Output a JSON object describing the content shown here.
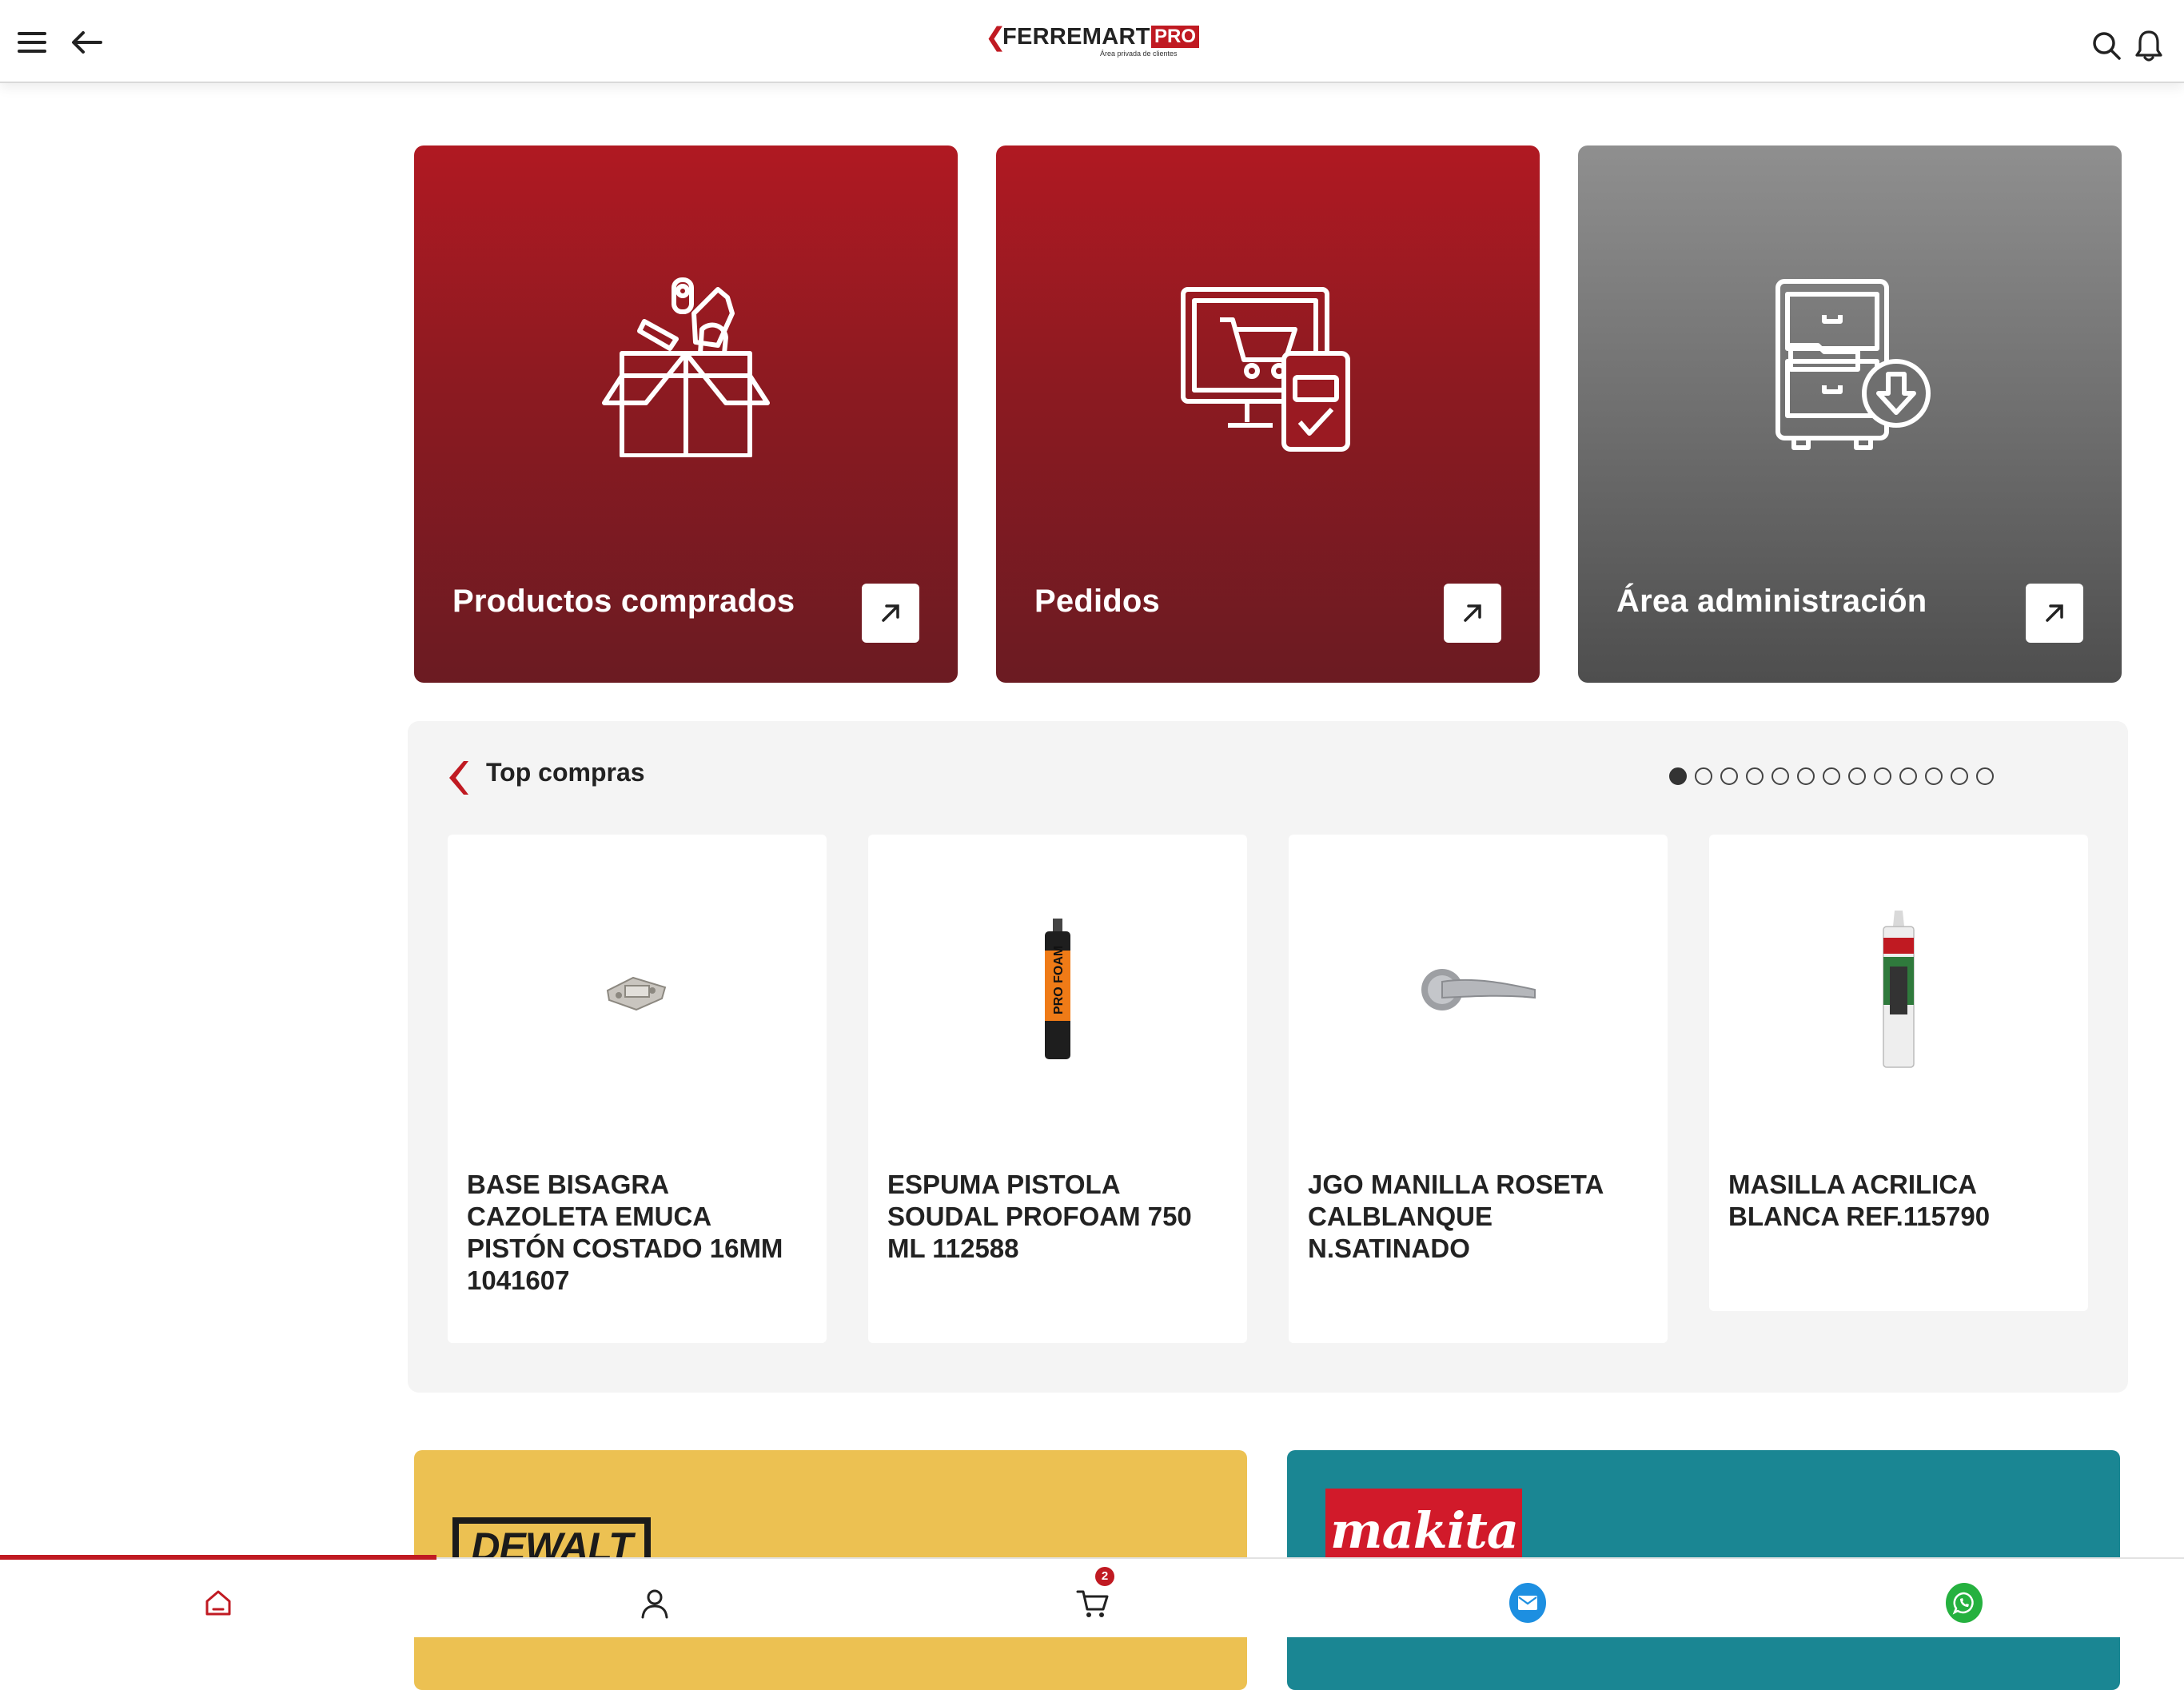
{
  "header": {
    "logo_word": "FERREMART",
    "logo_badge": "PRO",
    "logo_tagline": "Área privada de clientes"
  },
  "cards": [
    {
      "label": "Productos comprados"
    },
    {
      "label": "Pedidos"
    },
    {
      "label": "Área administración"
    }
  ],
  "top_compras": {
    "title": "Top compras",
    "page_count": 13,
    "active_page": 1,
    "products": [
      {
        "name": "BASE BISAGRA CAZOLETA EMUCA PISTÓN COSTADO 16MM 1041607"
      },
      {
        "name": "ESPUMA PISTOLA SOUDAL PROFOAM 750 ML 112588"
      },
      {
        "name": "JGO MANILLA ROSETA CALBLANQUE N.SATINADO"
      },
      {
        "name": "MASILLA ACRILICA BLANCA REF.115790"
      }
    ]
  },
  "brands": [
    {
      "name": "DEWALT"
    },
    {
      "name": "makita"
    }
  ],
  "bottom_nav": {
    "cart_count": "2",
    "items": [
      "home-icon",
      "user-icon",
      "cart-icon",
      "mail-icon",
      "whatsapp-icon"
    ]
  },
  "colors": {
    "brand_red": "#c01a22",
    "dewalt_yellow": "#ecc152",
    "makita_teal": "#1a8693",
    "mail_blue": "#1d8fe1",
    "whatsapp_green": "#25b13f"
  }
}
